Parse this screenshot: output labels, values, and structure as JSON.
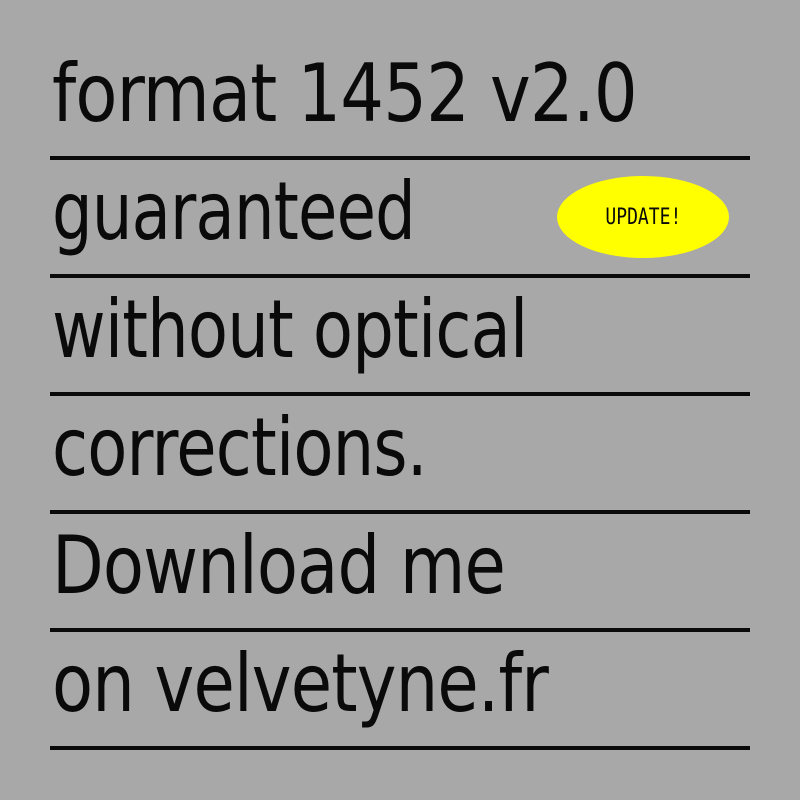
{
  "background_color": "#a8a8a8",
  "text_color": "#0a0a0a",
  "lines": [
    {
      "text": "format 1452 v2.0"
    },
    {
      "text": "guaranteed"
    },
    {
      "text": "without optical"
    },
    {
      "text": "corrections."
    },
    {
      "text": "Download me"
    },
    {
      "text": "on velvetyne.fr"
    }
  ],
  "badge": {
    "label": "UPDATE!",
    "color": "#ffff00"
  }
}
